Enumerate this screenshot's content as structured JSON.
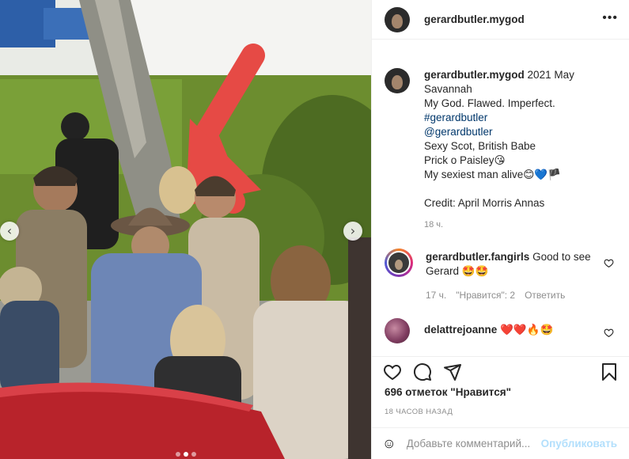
{
  "post": {
    "username": "gerardbutler.mygod",
    "caption": {
      "username": "gerardbutler.mygod",
      "line1": "2021 May",
      "line2": "Savannah",
      "line3": "My God. Flawed. Imperfect.",
      "hashtag": "#gerardbutler",
      "mention": "@gerardbutler",
      "line4": "Sexy Scot, British Babe",
      "line5": "Prick o Paisley😘",
      "line6": "My sexiest man alive😊💙🏴",
      "credit": "Credit: April Morris Annas",
      "time": "18 ч."
    }
  },
  "comments": [
    {
      "username": "gerardbutler.fangirls",
      "text": "Good to see Gerard 🤩🤩",
      "time": "17 ч.",
      "likes": "\"Нравится\": 2",
      "reply": "Ответить"
    },
    {
      "username": "delattrejoanne",
      "text": "❤️❤️🔥🤩"
    }
  ],
  "likes_text": "696 отметок \"Нравится\"",
  "post_time": "18 ЧАСОВ НАЗАД",
  "comment_input": {
    "placeholder": "Добавьте комментарий...",
    "publish": "Опубликовать"
  },
  "icons": {
    "more": "more-icon",
    "heart": "heart-icon",
    "comment": "comment-icon",
    "share": "share-icon",
    "bookmark": "bookmark-icon",
    "emoji": "emoji-icon"
  },
  "carousel": {
    "total": 3,
    "active_index": 1
  },
  "colors": {
    "link": "#00376b",
    "muted": "#8e8e8e",
    "publish": "#b2dffc"
  }
}
